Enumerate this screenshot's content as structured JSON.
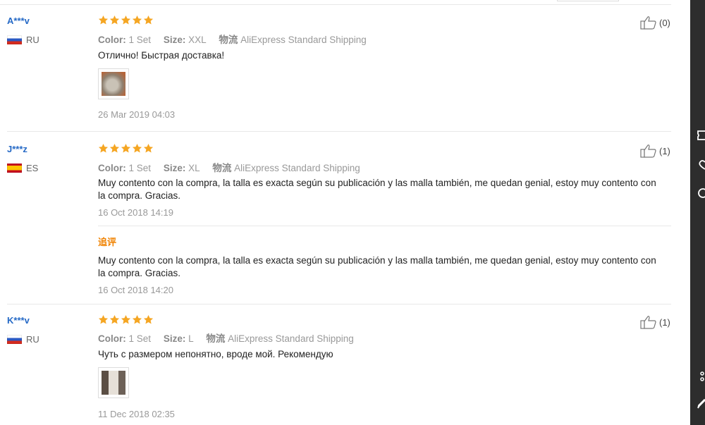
{
  "labels": {
    "color": "Color:",
    "size": "Size:",
    "logistics": "物流",
    "follow_up": "追评"
  },
  "reviews": [
    {
      "user": "A***v",
      "country": "RU",
      "rating": 5,
      "color": "1 Set",
      "size": "XXL",
      "shipping": "AliExpress Standard Shipping",
      "text": "Отлично! Быстрая доставка!",
      "date": "26 Mar 2019 04:03",
      "likes": "(0)"
    },
    {
      "user": "J***z",
      "country": "ES",
      "rating": 5,
      "color": "1 Set",
      "size": "XL",
      "shipping": "AliExpress Standard Shipping",
      "text": "Muy contento con la compra, la talla es exacta según su publicación y las malla también, me quedan genial, estoy muy contento con la compra. Gracias.",
      "date": "16 Oct 2018 14:19",
      "likes": "(1)",
      "follow_up": {
        "text": "Muy contento con la compra, la talla es exacta según su publicación y las malla también, me quedan genial, estoy muy contento con la compra. Gracias.",
        "date": "16 Oct 2018 14:20"
      }
    },
    {
      "user": "K***v",
      "country": "RU",
      "rating": 5,
      "color": "1 Set",
      "size": "L",
      "shipping": "AliExpress Standard Shipping",
      "text": "Чуть с размером непонятно, вроде мой. Рекомендую",
      "date": "11 Dec 2018 02:35",
      "likes": "(1)"
    }
  ],
  "colors": {
    "username": "#2569c6",
    "star": "#f5a623",
    "follow_up_label": "#f08200",
    "sidebar": "#2d2d2d"
  }
}
